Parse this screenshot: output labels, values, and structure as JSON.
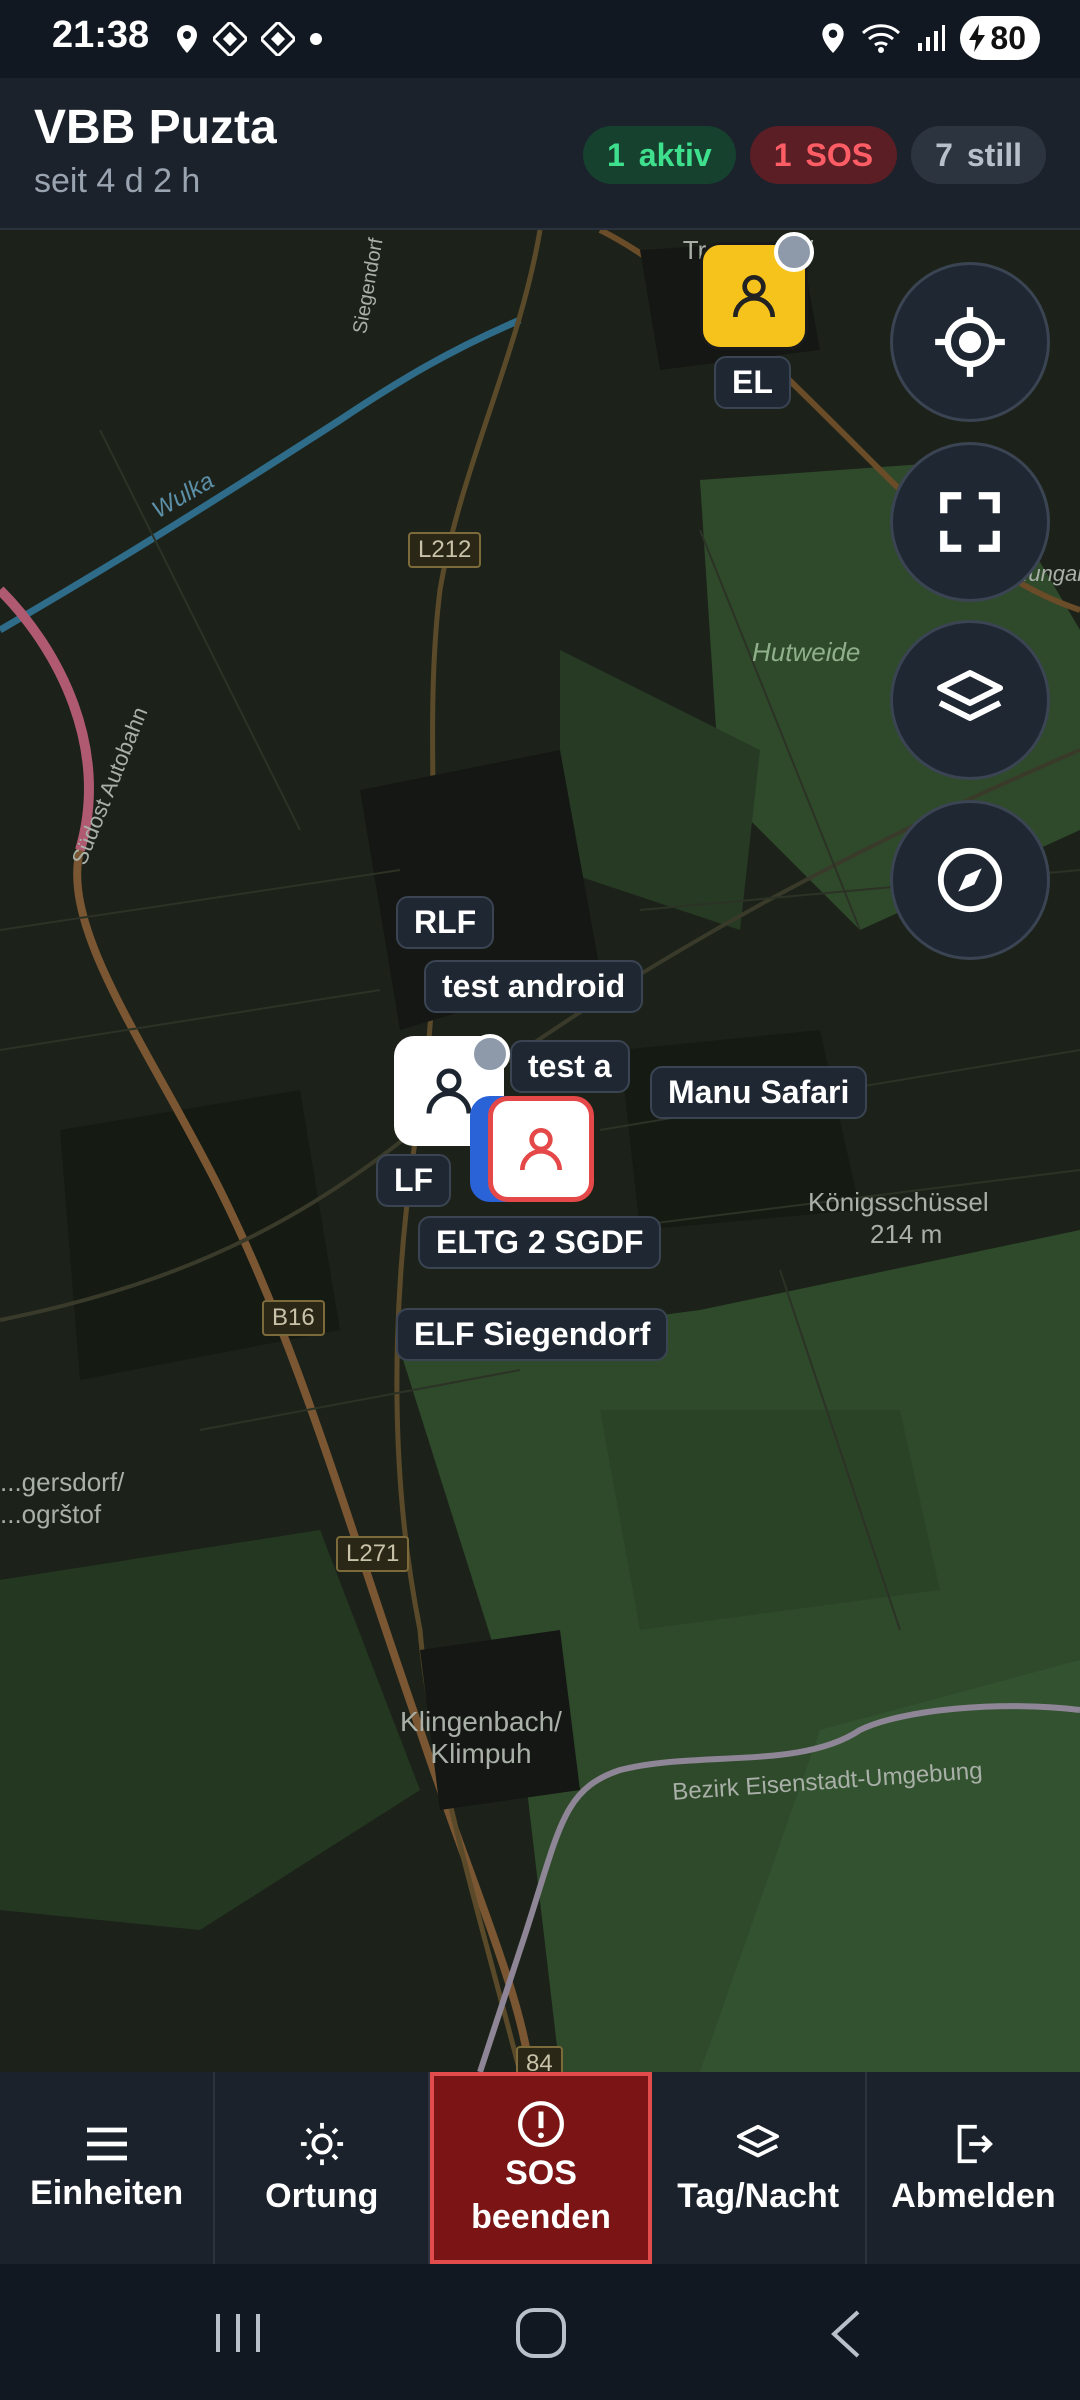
{
  "status_bar": {
    "time": "21:38",
    "battery": "80"
  },
  "header": {
    "title": "VBB Puzta",
    "subtitle": "seit 4 d 2 h",
    "badges": [
      {
        "count": "1",
        "label": "aktiv",
        "color": "#3ee08e"
      },
      {
        "count": "1",
        "label": "SOS",
        "color": "#ff5d66"
      },
      {
        "count": "7",
        "label": "still",
        "color": "#b7c0cb"
      }
    ]
  },
  "map": {
    "place_labels": {
      "trausdorf": "Tr... an ...a/ ...sof",
      "hutweide": "Hutweide",
      "siegendorf_road": "Siegendorf",
      "wulka": "Wulka",
      "autobahn": "Südost Autobahn",
      "koenigsschuessel": "Königsschüssel",
      "koenigsschuessel_alt": "214 m",
      "zagersdorf": "...gersdorf/ ...ogrštof",
      "klingenbach": "Klingenbach/ Klimpuh",
      "bezirk": "Bezirk Eisenstadt-Umgebung",
      "ungar": "...ungar"
    },
    "road_signs": {
      "l212": "L212",
      "b16": "B16",
      "l271": "L271",
      "r84": "84"
    },
    "units": {
      "el": "EL",
      "rlf": "RLF",
      "test_android": "test android",
      "test_a": "test a",
      "manu_safari": "Manu Safari",
      "lf": "LF",
      "eltg": "ELTG 2 SGDF",
      "elf": "ELF Siegendorf"
    }
  },
  "map_controls": [
    "locate-icon",
    "fullscreen-icon",
    "layers-icon",
    "compass-icon"
  ],
  "bottom_nav": {
    "einheiten": "Einheiten",
    "ortung": "Ortung",
    "sos_line1": "SOS",
    "sos_line2": "beenden",
    "tagnacht": "Tag/Nacht",
    "abmelden": "Abmelden"
  },
  "colors": {
    "sos": "#e34c4c",
    "active": "#3ee08e",
    "accent_yellow": "#f6c31c"
  }
}
